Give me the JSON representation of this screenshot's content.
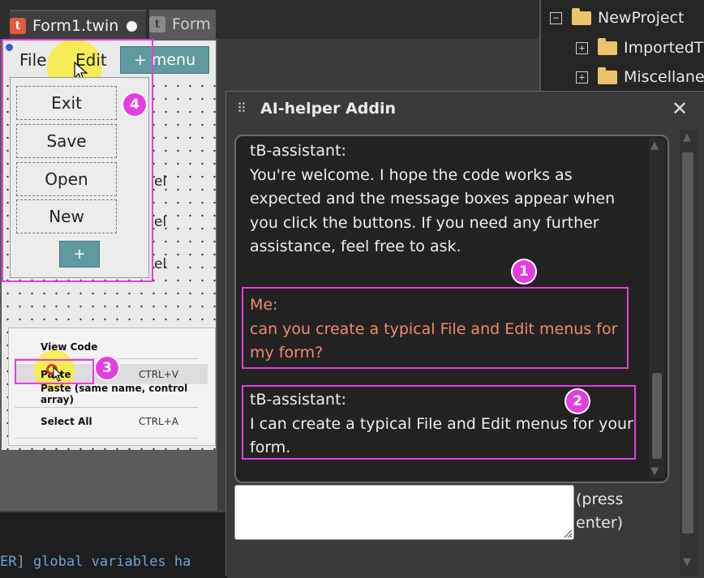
{
  "tabs": [
    {
      "label": "Form1.twin",
      "icon": "t",
      "modified": true
    },
    {
      "label": "Form",
      "icon": "t"
    }
  ],
  "project_tree": {
    "items": [
      {
        "toggle": "−",
        "label": "NewProject"
      },
      {
        "toggle": "+",
        "label": "ImportedT"
      },
      {
        "toggle": "+",
        "label": "Miscellane"
      }
    ]
  },
  "designer": {
    "menubar": {
      "file": "File",
      "edit": "Edit",
      "menu_button": "+ menu"
    },
    "file_menu": {
      "items": [
        "Exit",
        "Save",
        "Open",
        "New"
      ],
      "plus": "+"
    },
    "label_fragments": [
      "el",
      "el",
      "el"
    ],
    "context_menu": {
      "items": [
        {
          "label": "View Code",
          "shortcut": ""
        },
        {
          "label": "Paste",
          "shortcut": "CTRL+V"
        },
        {
          "label": "Paste (same name, control array)",
          "shortcut": ""
        },
        {
          "label": "Select All",
          "shortcut": "CTRL+A"
        }
      ]
    }
  },
  "output": {
    "text": "ER] global variables ha"
  },
  "ai_panel": {
    "title": "AI-helper Addin",
    "close": "✕",
    "messages": [
      {
        "sender": "tB-assistant:",
        "text": "You're welcome. I hope the code works as expected and the message boxes appear when you click the buttons. If you need any further assistance, feel free to ask.",
        "lines": [
          "You're welcome. I hope the code works as",
          "expected and the message boxes appear when",
          "you click the buttons. If you need any further",
          "assistance, feel free to ask."
        ]
      },
      {
        "sender": "Me:",
        "text": "can you create a typical File and Edit menus for my form?",
        "lines": [
          "can you create a typical File and Edit menus for",
          "my form?"
        ]
      },
      {
        "sender": "tB-assistant:",
        "text": "I can create a typical File and Edit menus for your form.",
        "lines": [
          "I can create a typical File and Edit menus for your",
          "form."
        ]
      }
    ],
    "input_hint": {
      "line1": "(press",
      "line2": "enter)"
    }
  },
  "annotations": [
    "1",
    "2",
    "3",
    "4"
  ],
  "colors": {
    "highlight": "#e53ee0",
    "accent_teal": "#5e9aa0",
    "user_message": "#f08a72"
  }
}
